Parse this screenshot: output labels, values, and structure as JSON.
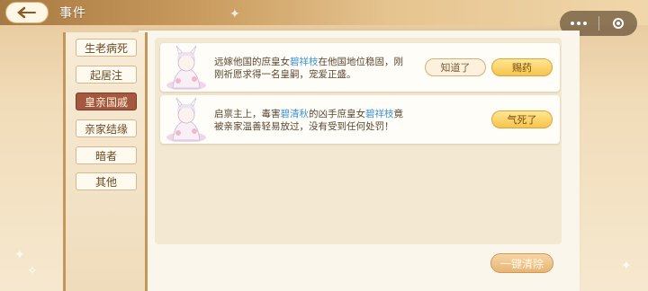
{
  "header": {
    "title": "事件"
  },
  "sidebar": {
    "tabs": [
      {
        "label": "生老病死",
        "active": false
      },
      {
        "label": "起居注",
        "active": false
      },
      {
        "label": "皇亲国戚",
        "active": true
      },
      {
        "label": "亲家结缘",
        "active": false
      },
      {
        "label": "暗者",
        "active": false
      },
      {
        "label": "其他",
        "active": false
      }
    ]
  },
  "events": [
    {
      "avatar_icon": "princess-portrait",
      "text_before": "远嫁他国的庶皇女",
      "highlight": "碧祥枝",
      "text_after": "在他国地位稳固，刚刚祈愿求得一名皇嗣，宠爱正盛。",
      "buttons": [
        "知道了",
        "赐药"
      ]
    },
    {
      "avatar_icon": "princess-portrait",
      "text_before": "启禀主上，毒害",
      "highlight": "碧清秋",
      "text_middle": "的凶手庶皇女",
      "highlight2": "碧祥枝",
      "text_after": "竟被亲家温善轻易放过，没有受到任何处罚！",
      "buttons": [
        "气死了"
      ]
    }
  ],
  "footer": {
    "clear_all_label": "一键清除"
  },
  "colors": {
    "highlight": "#3e93d6",
    "active_tab": "#a4583f",
    "gold_button": "#f6c44c"
  }
}
